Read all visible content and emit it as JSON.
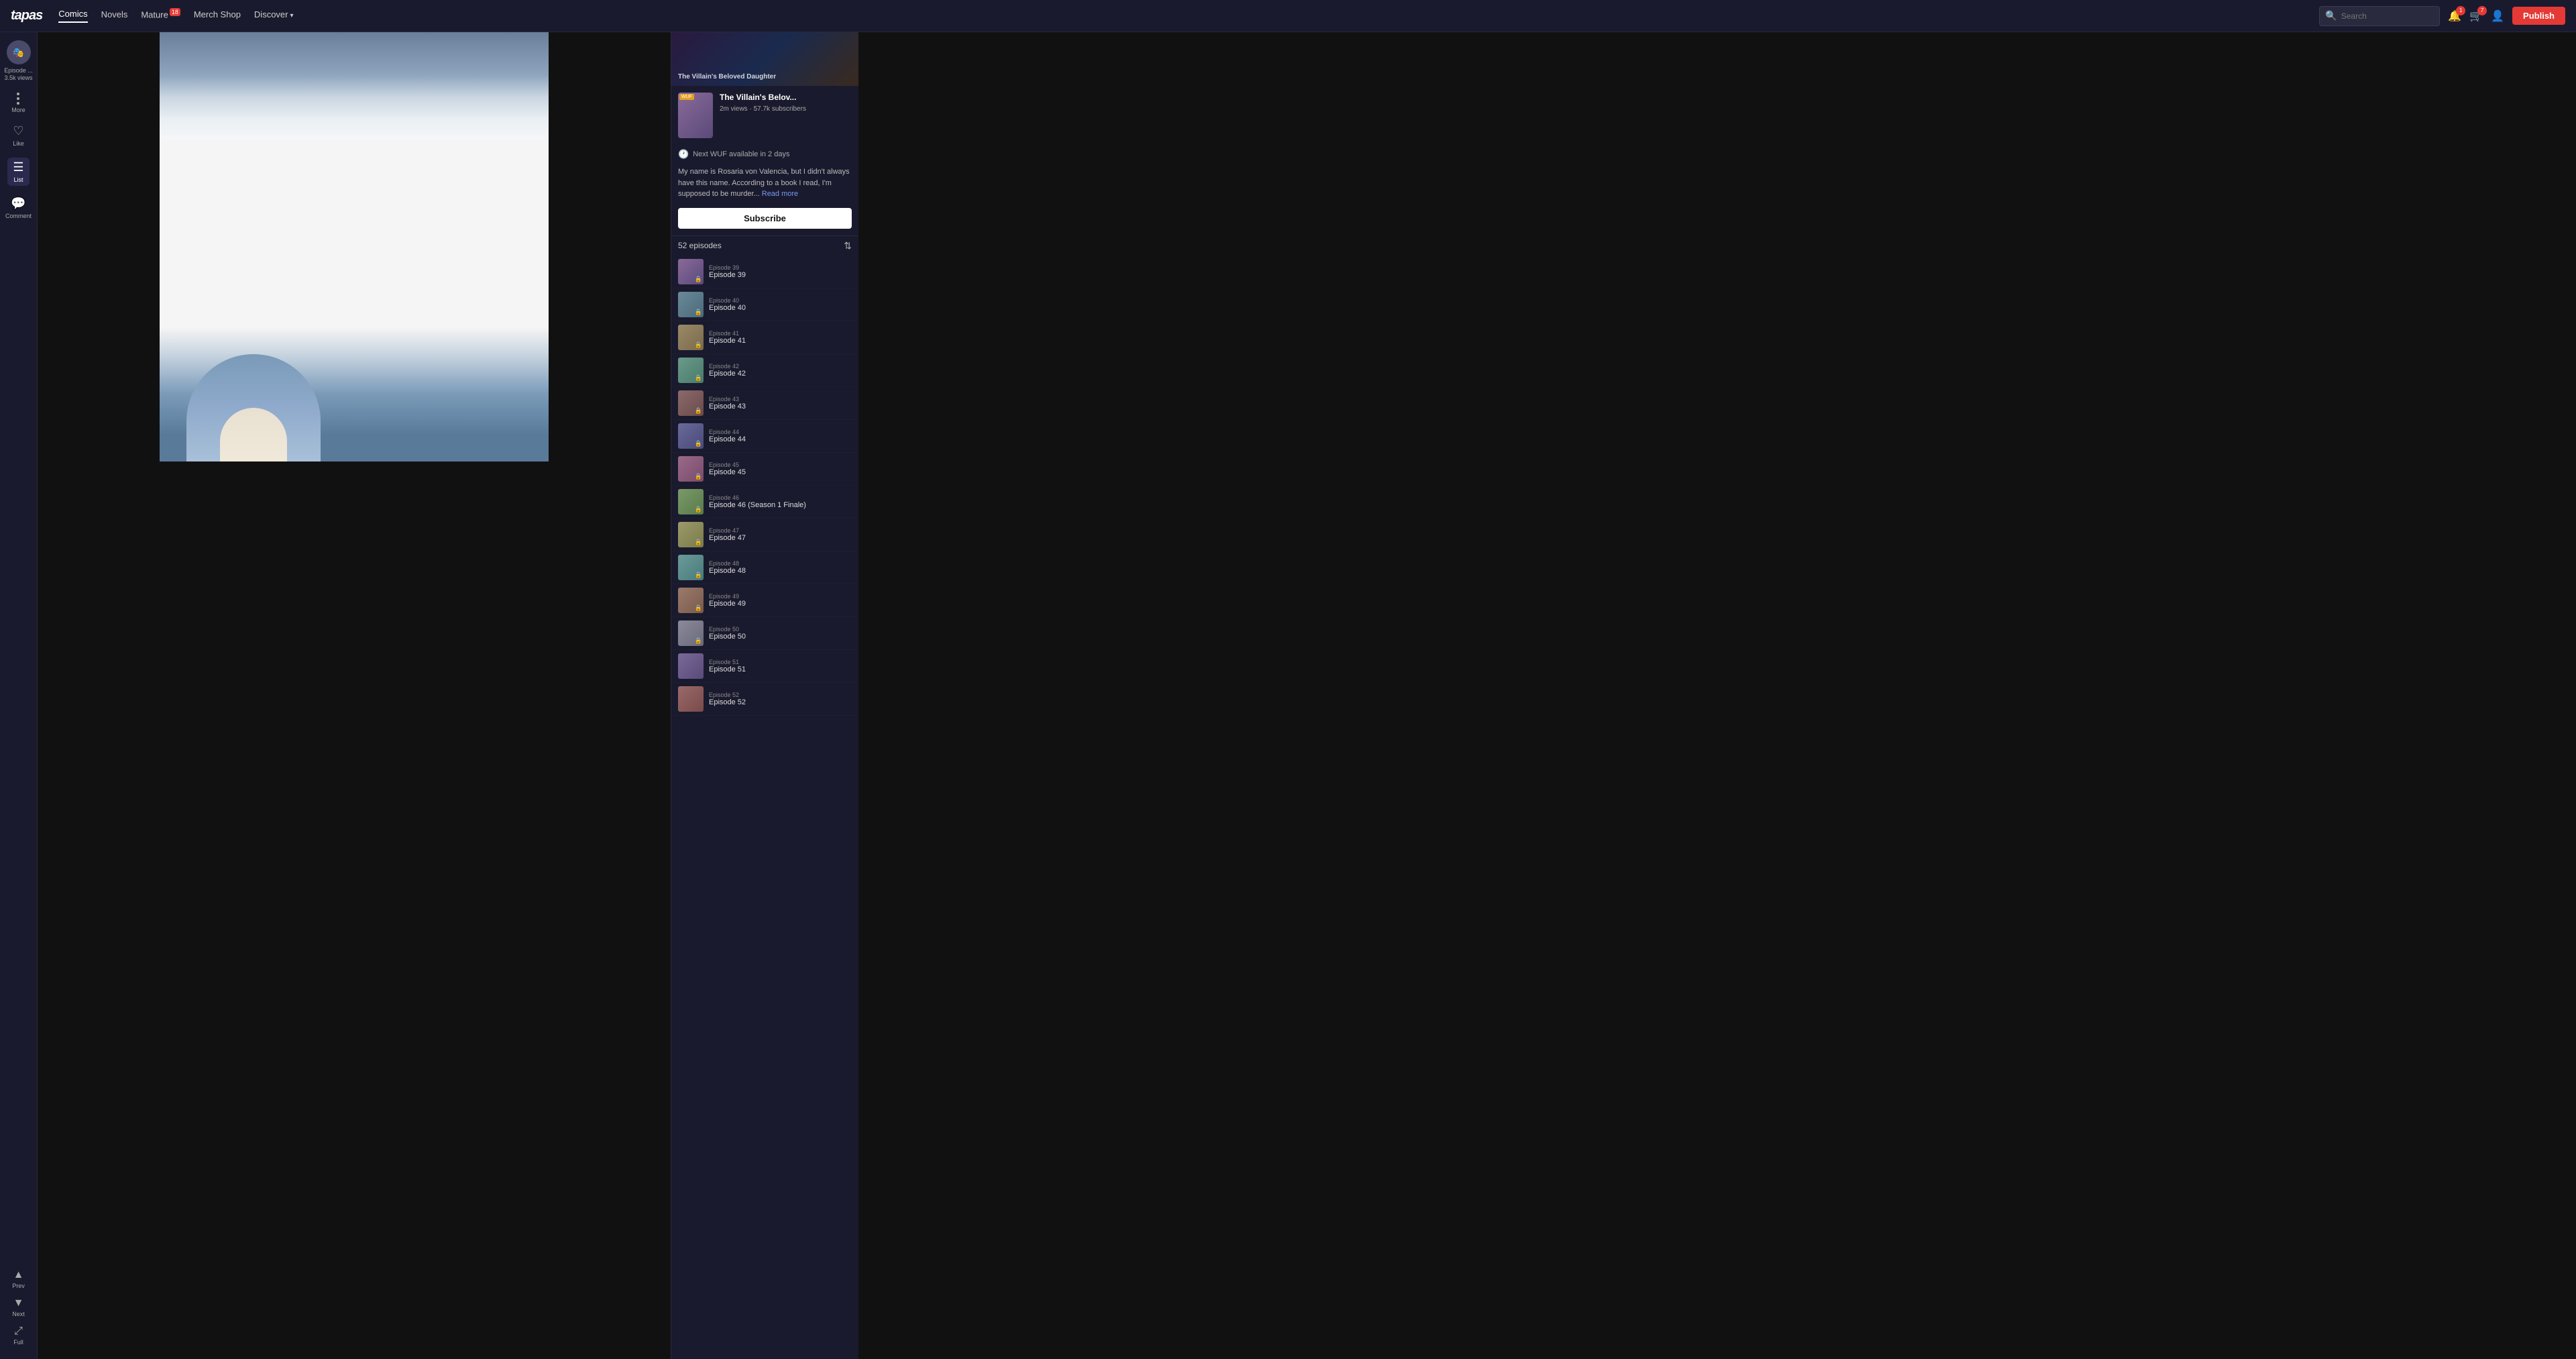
{
  "header": {
    "logo": "tapas",
    "nav": [
      {
        "id": "comics",
        "label": "Comics",
        "active": true
      },
      {
        "id": "novels",
        "label": "Novels",
        "active": false
      },
      {
        "id": "mature",
        "label": "Mature",
        "badge": "18",
        "active": false
      },
      {
        "id": "merch",
        "label": "Merch Shop",
        "active": false
      },
      {
        "id": "discover",
        "label": "Discover",
        "hasChevron": true,
        "active": false
      }
    ],
    "search_placeholder": "Search",
    "publish_label": "Publish",
    "notification_count": "1",
    "cart_count": "7"
  },
  "left_sidebar": {
    "episode_label": "Episode ...",
    "views": "3.5k views",
    "more_label": "More",
    "like_label": "Like",
    "list_label": "List",
    "comment_label": "Comment",
    "prev_label": "Prev",
    "next_label": "Next",
    "full_label": "Full"
  },
  "right_sidebar": {
    "series_title": "The Villain's Belov...",
    "series_full_title": "The Villain's Beloved Daughter",
    "views": "2m views",
    "subscribers": "57.7k subscribers",
    "wuf_notice": "Next WUF available in 2 days",
    "description": "My name is Rosaria von Valencia, but I didn't always have this name. According to a book I read, I'm supposed to be murder...",
    "read_more": "Read more",
    "subscribe_label": "Subscribe",
    "episodes_count": "52 episodes",
    "episodes": [
      {
        "id": 39,
        "label": "Episode 39",
        "title": "Episode 39",
        "locked": true
      },
      {
        "id": 40,
        "label": "Episode 40",
        "title": "Episode 40",
        "locked": true
      },
      {
        "id": 41,
        "label": "Episode 41",
        "title": "Episode 41",
        "locked": true
      },
      {
        "id": 42,
        "label": "Episode 42",
        "title": "Episode 42",
        "locked": true
      },
      {
        "id": 43,
        "label": "Episode 43",
        "title": "Episode 43",
        "locked": true
      },
      {
        "id": 44,
        "label": "Episode 44",
        "title": "Episode 44",
        "locked": true
      },
      {
        "id": 45,
        "label": "Episode 45",
        "title": "Episode 45",
        "locked": true
      },
      {
        "id": 46,
        "label": "Episode 46",
        "title": "Episode 46 (Season 1 Finale)",
        "locked": true
      },
      {
        "id": 47,
        "label": "Episode 47",
        "title": "Episode 47",
        "locked": true
      },
      {
        "id": 48,
        "label": "Episode 48",
        "title": "Episode 48",
        "locked": true
      },
      {
        "id": 49,
        "label": "Episode 49",
        "title": "Episode 49",
        "locked": true
      },
      {
        "id": 50,
        "label": "Episode 50",
        "title": "Episode 50",
        "locked": true
      },
      {
        "id": 51,
        "label": "Episode 51",
        "title": "Episode 51",
        "locked": false
      },
      {
        "id": 52,
        "label": "Episode 52",
        "title": "Episode 52",
        "locked": false
      }
    ]
  }
}
